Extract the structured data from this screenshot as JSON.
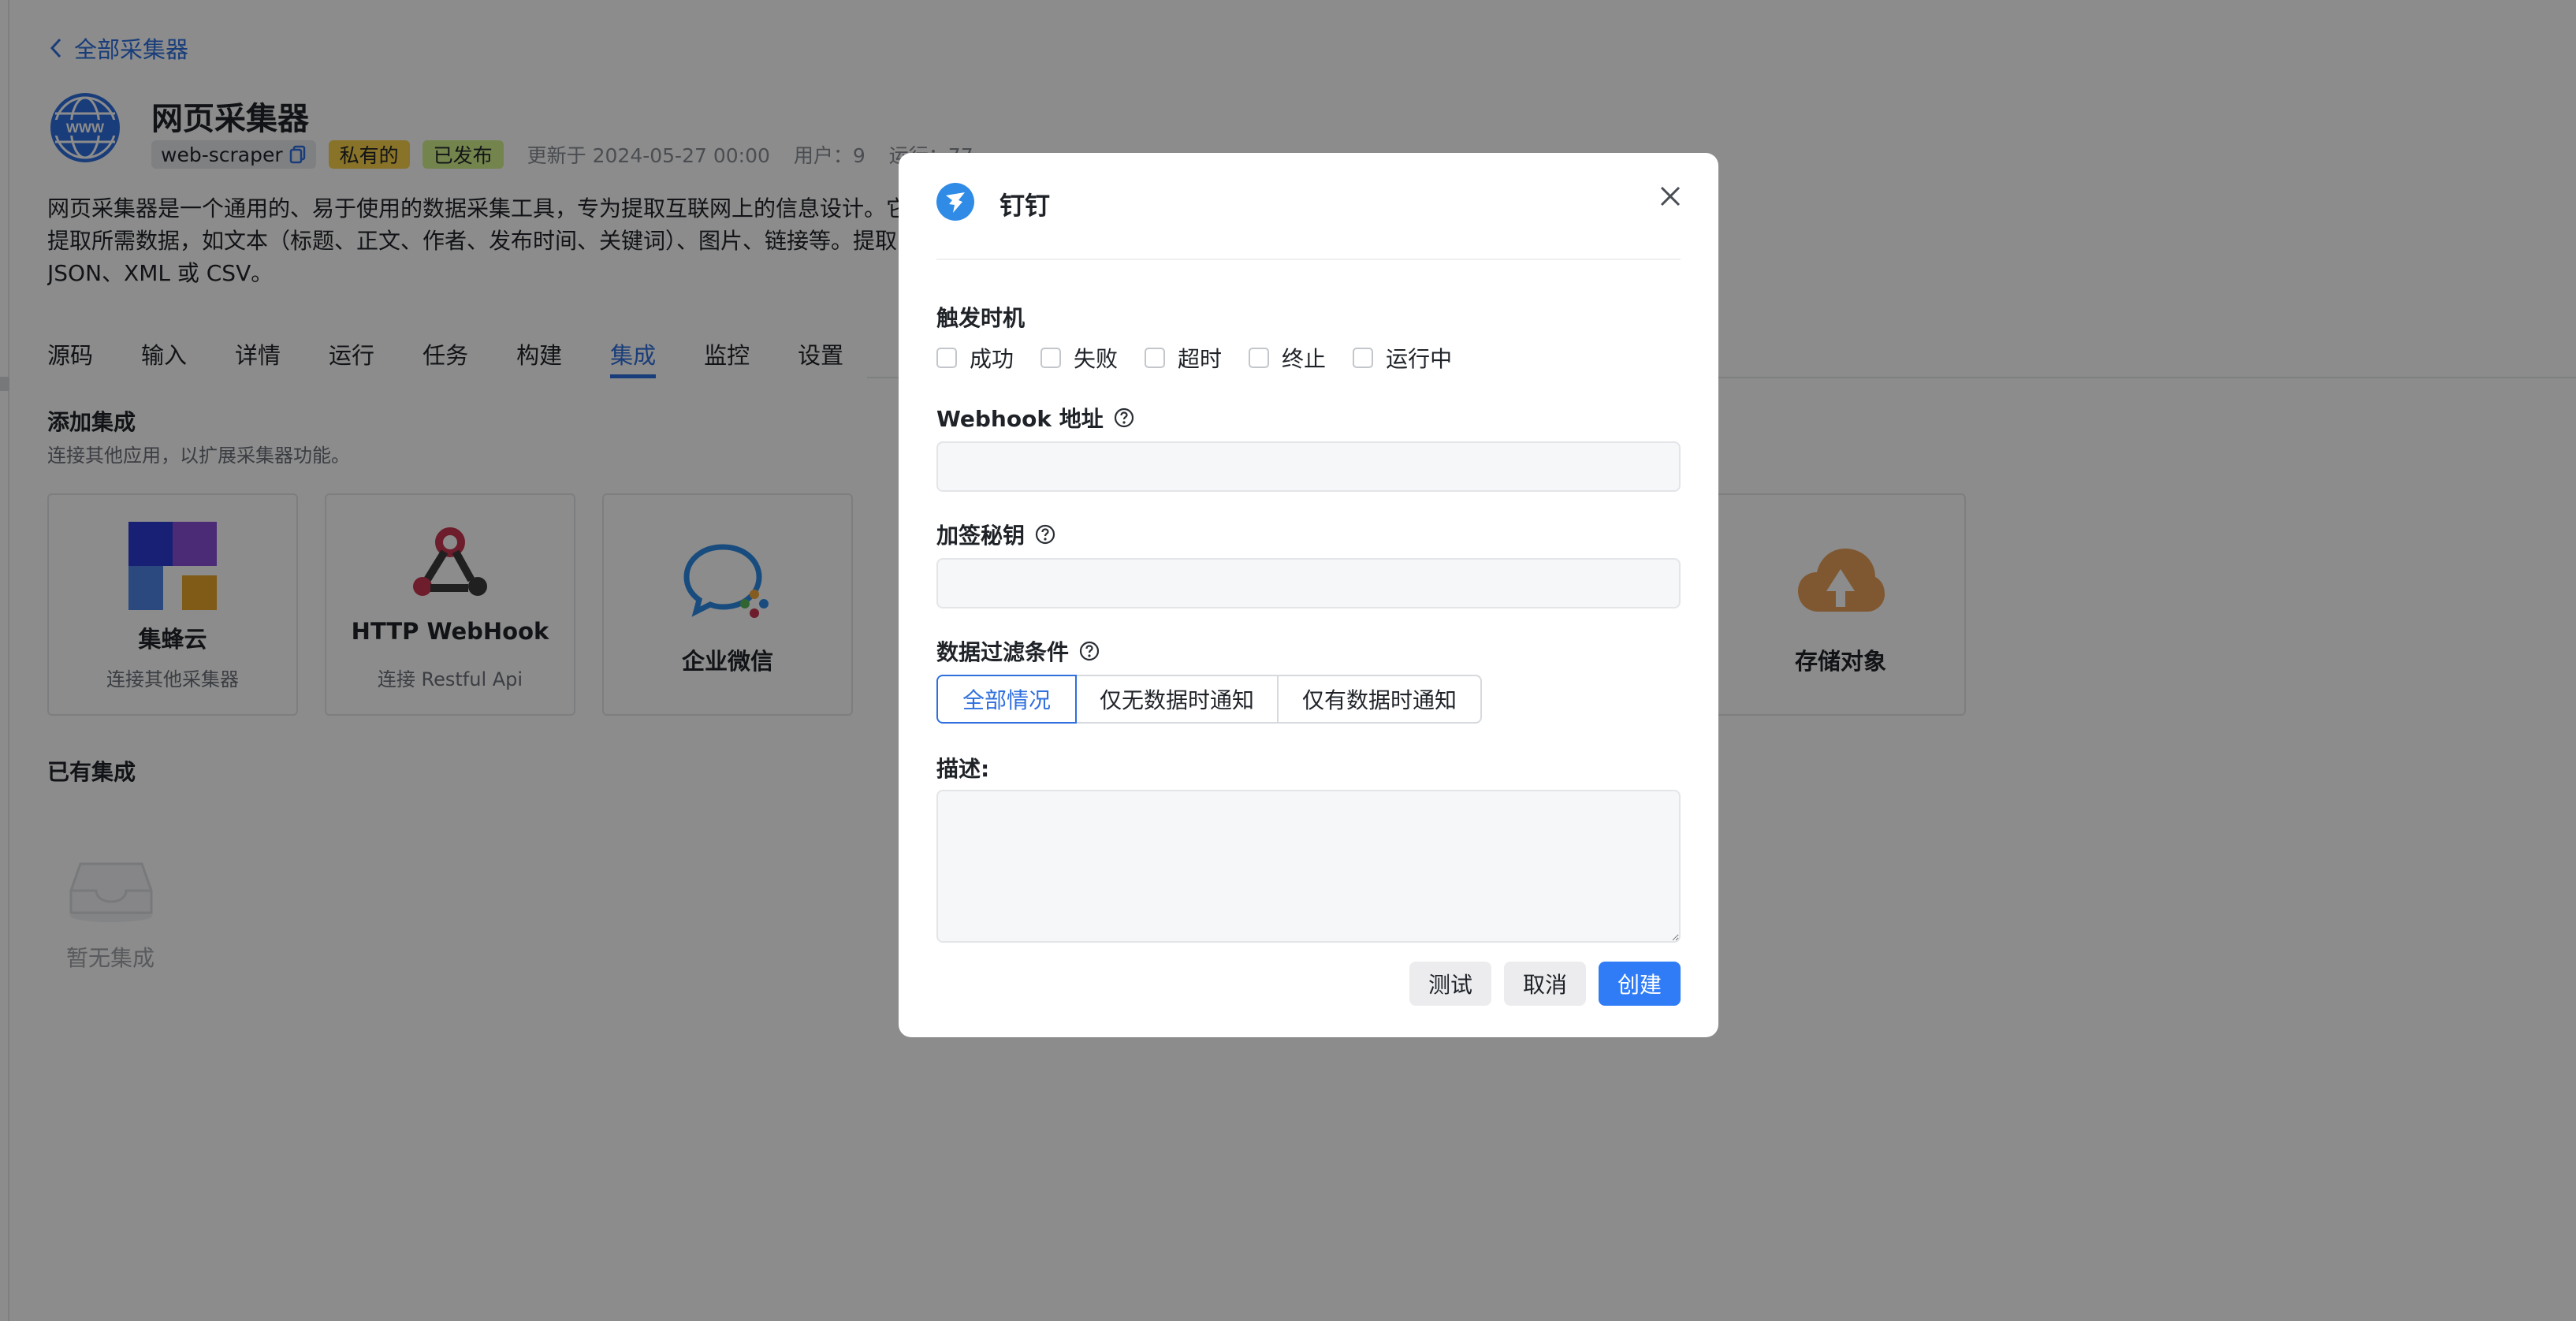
{
  "header": {
    "back_label": "全部采集器",
    "title": "网页采集器",
    "slug": "web-scraper",
    "badge_private": "私有的",
    "badge_published": "已发布",
    "updated": "更新于 2024-05-27 00:00",
    "users": "用户：9",
    "runs": "运行：77"
  },
  "description": {
    "line1": "网页采集器是一个通用的、易于使用的数据采集工具，专为提取互联网上的信息设计。它",
    "line2": "提取所需数据，如文本（标题、正文、作者、发布时间、关键词）、图片、链接等。提取",
    "line3": "JSON、XML 或 CSV。"
  },
  "tabs": [
    "源码",
    "输入",
    "详情",
    "运行",
    "任务",
    "构建",
    "集成",
    "监控",
    "设置"
  ],
  "active_tab": "集成",
  "add_section": {
    "title": "添加集成",
    "subtitle": "连接其他应用，以扩展采集器功能。"
  },
  "cards": [
    {
      "title": "集蜂云",
      "subtitle": "连接其他采集器"
    },
    {
      "title": "HTTP WebHook",
      "subtitle": "连接 Restful Api"
    },
    {
      "title": "企业微信",
      "subtitle": ""
    },
    {
      "title": "存储对象",
      "subtitle": ""
    }
  ],
  "existing_section": {
    "title": "已有集成",
    "empty_text": "暂无集成"
  },
  "modal": {
    "title": "钉钉",
    "trigger_label": "触发时机",
    "triggers": [
      "成功",
      "失败",
      "超时",
      "终止",
      "运行中"
    ],
    "webhook_label": "Webhook 地址",
    "webhook_value": "",
    "secret_label": "加签秘钥",
    "secret_value": "",
    "filter_label": "数据过滤条件",
    "filter_options": [
      "全部情况",
      "仅无数据时通知",
      "仅有数据时通知"
    ],
    "filter_selected": "全部情况",
    "desc_label": "描述:",
    "desc_value": "",
    "btn_test": "测试",
    "btn_cancel": "取消",
    "btn_create": "创建"
  },
  "colors": {
    "accent": "#2f6fde",
    "primary_button": "#2f7cf6",
    "badge_private": "#f8d14a",
    "badge_published": "#d3f08c",
    "overlay": "rgba(0,0,0,0.45)"
  }
}
